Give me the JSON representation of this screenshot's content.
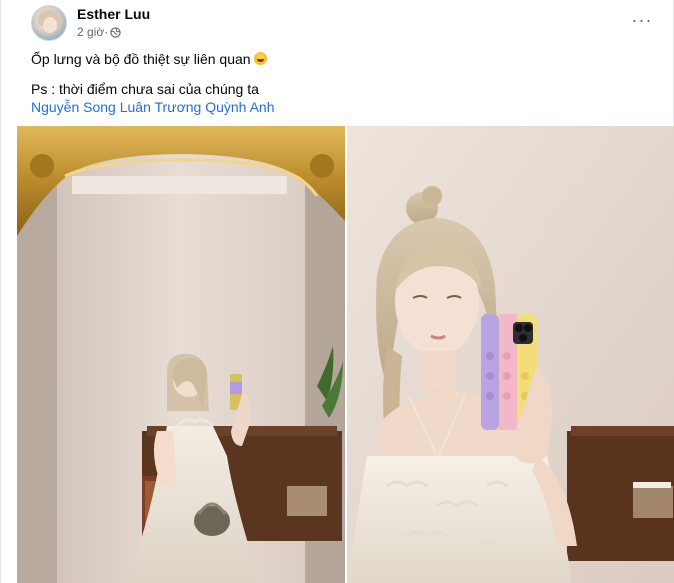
{
  "post": {
    "author": "Esther Luu",
    "time": "2 giờ",
    "time_separator": " · ",
    "privacy_icon": "globe-icon",
    "more_icon": "more-options-icon",
    "more_label": "···",
    "caption": "Ốp lưng và bộ đồ thiệt sự liên quan",
    "caption_emoji": "laughing-face-emoji",
    "ps_line": "Ps : thời điểm chưa sai của chúng ta",
    "tags": [
      "Nguyễn Song Luân",
      "Trương Quỳnh Anh"
    ]
  },
  "photos": {
    "count": 2,
    "items": [
      {
        "icon": "photo-mirror-selfie-full"
      },
      {
        "icon": "photo-mirror-selfie-closeup"
      }
    ]
  },
  "colors": {
    "link": "#216fdb",
    "secondary_text": "#65676b",
    "primary_text": "#050505"
  }
}
